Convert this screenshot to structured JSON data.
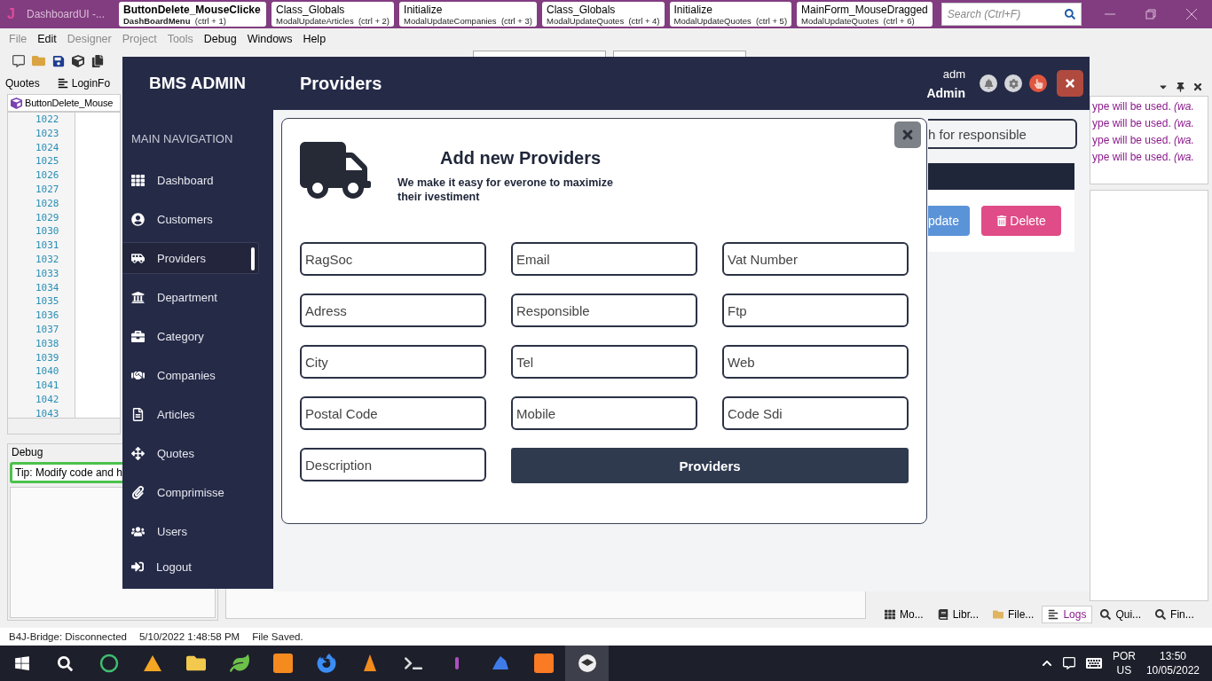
{
  "ide": {
    "logo": "J",
    "title": "DashboardUI -...",
    "tabs": [
      {
        "title": "ButtonDelete_MouseClicke",
        "module": "DashBoardMenu",
        "shortcut": "(ctrl + 1)",
        "selected": true
      },
      {
        "title": "Class_Globals",
        "module": "ModalUpdateArticles",
        "shortcut": "(ctrl + 2)",
        "selected": false
      },
      {
        "title": "Initialize",
        "module": "ModalUpdateCompanies",
        "shortcut": "(ctrl + 3)",
        "selected": false
      },
      {
        "title": "Class_Globals",
        "module": "ModalUpdateQuotes",
        "shortcut": "(ctrl + 4)",
        "selected": false
      },
      {
        "title": "Initialize",
        "module": "ModalUpdateQuotes",
        "shortcut": "(ctrl + 5)",
        "selected": false
      },
      {
        "title": "MainForm_MouseDragged",
        "module": "ModalUpdateQuotes",
        "shortcut": "(ctrl + 6)",
        "selected": false
      }
    ],
    "search": {
      "placeholder": "Search (Ctrl+F)"
    },
    "menu": [
      {
        "label": "File",
        "disabled": true
      },
      {
        "label": "Edit",
        "disabled": false
      },
      {
        "label": "Designer",
        "disabled": true
      },
      {
        "label": "Project",
        "disabled": true
      },
      {
        "label": "Tools",
        "disabled": true
      },
      {
        "label": "Debug",
        "disabled": false
      },
      {
        "label": "Windows",
        "disabled": false
      },
      {
        "label": "Help",
        "disabled": false
      }
    ],
    "panel_tabs": [
      "Quotes",
      "LoginFo"
    ],
    "doc_tab": "ButtonDelete_Mouse",
    "line_numbers": [
      "1022",
      "1023",
      "1024",
      "1025",
      "1026",
      "1027",
      "1028",
      "1029",
      "1030",
      "1031",
      "1032",
      "1033",
      "1034",
      "1035",
      "1036",
      "1037",
      "1038",
      "1039",
      "1040",
      "1041",
      "1042",
      "1043"
    ],
    "debug": {
      "title": "Debug",
      "tip": "Tip: Modify code and h"
    },
    "logs": [
      "ype will be used. *(wa.*",
      "ype will be used. *(wa.*",
      "ype will be used. *(wa.*",
      "ype will be used. *(wa.*"
    ],
    "bottom_tabs": [
      {
        "label": "Mo...",
        "selected": false
      },
      {
        "label": "Libr...",
        "selected": false
      },
      {
        "label": "File...",
        "selected": false
      },
      {
        "label": "Logs",
        "selected": true
      },
      {
        "label": "Qui...",
        "selected": false
      },
      {
        "label": "Fin...",
        "selected": false
      }
    ],
    "status_bar": [
      "B4J-Bridge: Disconnected",
      "5/10/2022 1:48:58 PM",
      "File Saved."
    ]
  },
  "app": {
    "brand": "BMS ADMIN",
    "page_title": "Providers",
    "user": {
      "login": "adm",
      "role": "Admin"
    },
    "nav_heading": "MAIN NAVIGATION",
    "nav": [
      {
        "label": "Dashboard",
        "selected": false
      },
      {
        "label": "Customers",
        "selected": false
      },
      {
        "label": "Providers",
        "selected": true
      },
      {
        "label": "Department",
        "selected": false
      },
      {
        "label": "Category",
        "selected": false
      },
      {
        "label": "Companies",
        "selected": false
      },
      {
        "label": "Articles",
        "selected": false
      },
      {
        "label": "Quotes",
        "selected": false
      },
      {
        "label": "Comprimisse",
        "selected": false
      },
      {
        "label": "Users",
        "selected": false
      }
    ],
    "logout": "Logout",
    "content": {
      "search": {
        "placeholder": "h for  responsible"
      },
      "buttons": [
        "pdate",
        "Delete"
      ]
    },
    "modal": {
      "title": "Add new Providers",
      "subtitle": "We make it easy for everone to maximize their ivestiment",
      "fields": [
        {
          "placeholder": "RagSoc"
        },
        {
          "placeholder": "Email"
        },
        {
          "placeholder": "Vat Number"
        },
        {
          "placeholder": "Adress"
        },
        {
          "placeholder": "Responsible"
        },
        {
          "placeholder": "Ftp"
        },
        {
          "placeholder": "City"
        },
        {
          "placeholder": "Tel"
        },
        {
          "placeholder": "Web"
        },
        {
          "placeholder": "Postal Code"
        },
        {
          "placeholder": "Mobile"
        },
        {
          "placeholder": "Code Sdi"
        },
        {
          "placeholder": "Description"
        }
      ],
      "submit": "Providers"
    }
  },
  "taskbar": {
    "buttons": [
      {
        "selected": false
      },
      {
        "selected": false
      },
      {
        "selected": false
      },
      {
        "selected": false
      },
      {
        "selected": false
      },
      {
        "selected": false
      },
      {
        "selected": false
      },
      {
        "selected": false
      },
      {
        "selected": false
      },
      {
        "selected": false
      },
      {
        "selected": false
      },
      {
        "selected": false
      },
      {
        "selected": true
      }
    ],
    "tray": {
      "language": "POR",
      "region": "US",
      "time": "13:50",
      "date": "10/05/2022"
    }
  }
}
